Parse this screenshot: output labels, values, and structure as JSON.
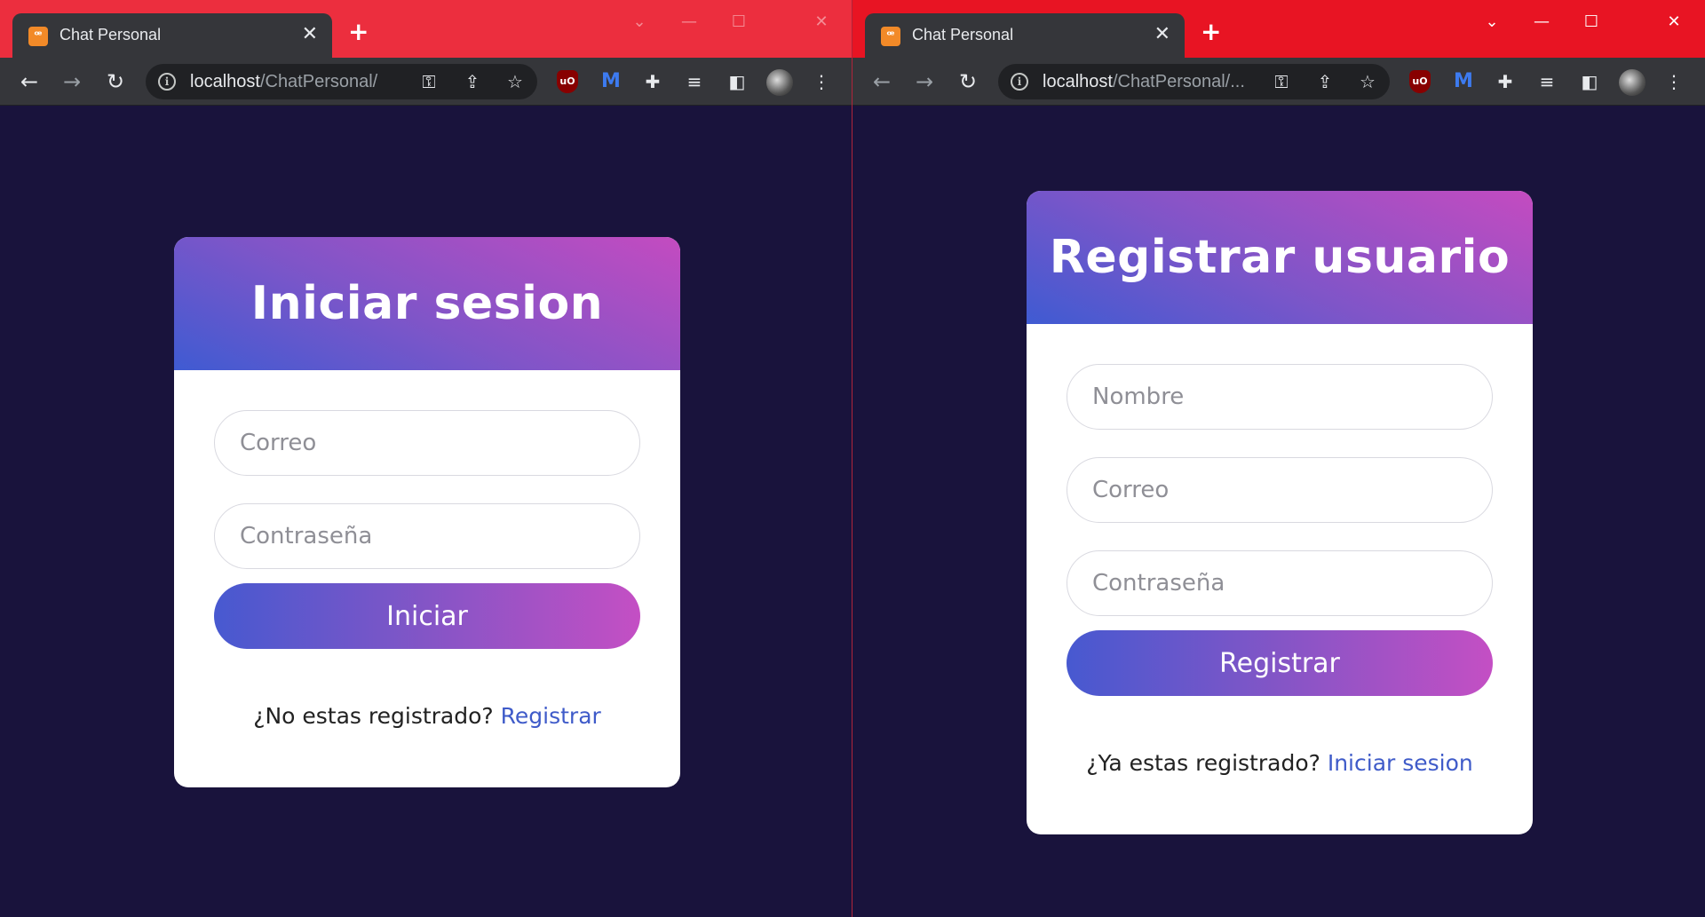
{
  "windows": [
    {
      "tab_title": "Chat Personal",
      "tab_close": "✕",
      "new_tab": "+",
      "url_host": "localhost",
      "url_path": "/ChatPersonal/",
      "card": {
        "title": "Iniciar sesion",
        "fields": [
          {
            "placeholder": "Correo"
          },
          {
            "placeholder": "Contraseña"
          }
        ],
        "button": "Iniciar",
        "footer_text": "¿No estas registrado? ",
        "footer_link": "Registrar"
      }
    },
    {
      "tab_title": "Chat Personal",
      "tab_close": "✕",
      "new_tab": "+",
      "url_host": "localhost",
      "url_path": "/ChatPersonal/...",
      "card": {
        "title": "Registrar usuario",
        "fields": [
          {
            "placeholder": "Nombre"
          },
          {
            "placeholder": "Correo"
          },
          {
            "placeholder": "Contraseña"
          }
        ],
        "button": "Registrar",
        "footer_text": "¿Ya estas registrado? ",
        "footer_link": "Iniciar sesion"
      }
    }
  ],
  "icons": {
    "back": "←",
    "forward": "→",
    "reload": "↻",
    "minimize": "—",
    "maximize": "☐",
    "close": "✕",
    "tab_favicon": "ꟹ"
  },
  "colors": {
    "page_background": "#19133c",
    "tabbar_left": "#ec2e3e",
    "tabbar_right": "#e81423",
    "gradient_start": "#4759d0",
    "gradient_end": "#c44fc4",
    "link": "#3f5bc9"
  }
}
